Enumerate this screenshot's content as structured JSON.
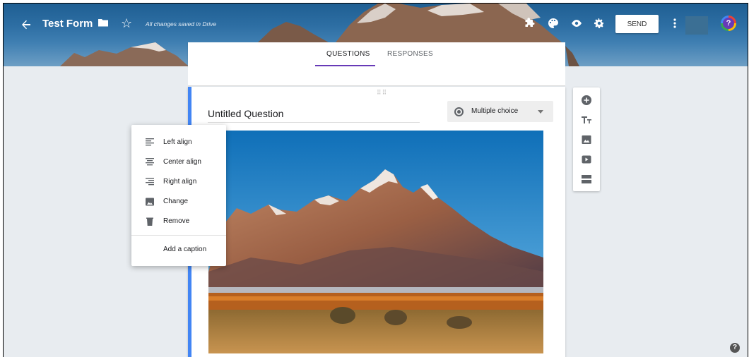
{
  "header": {
    "title": "Test Form",
    "saved_status": "All changes saved in Drive",
    "send_label": "SEND"
  },
  "tabs": [
    {
      "label": "QUESTIONS",
      "active": true
    },
    {
      "label": "RESPONSES",
      "active": false
    }
  ],
  "question": {
    "title": "Untitled Question",
    "type_label": "Multiple choice"
  },
  "image_menu": {
    "items": [
      {
        "label": "Left align",
        "icon": "align-left-icon"
      },
      {
        "label": "Center align",
        "icon": "align-center-icon"
      },
      {
        "label": "Right align",
        "icon": "align-right-icon"
      },
      {
        "label": "Change",
        "icon": "image-icon"
      },
      {
        "label": "Remove",
        "icon": "trash-icon"
      }
    ],
    "caption_label": "Add a caption"
  },
  "side_toolbar": [
    "add-question-icon",
    "title-text-icon",
    "add-image-icon",
    "add-video-icon",
    "add-section-icon"
  ],
  "colors": {
    "accent": "#673ab7",
    "question_border": "#4285f4",
    "banner_sky": "#2d6ea3"
  }
}
